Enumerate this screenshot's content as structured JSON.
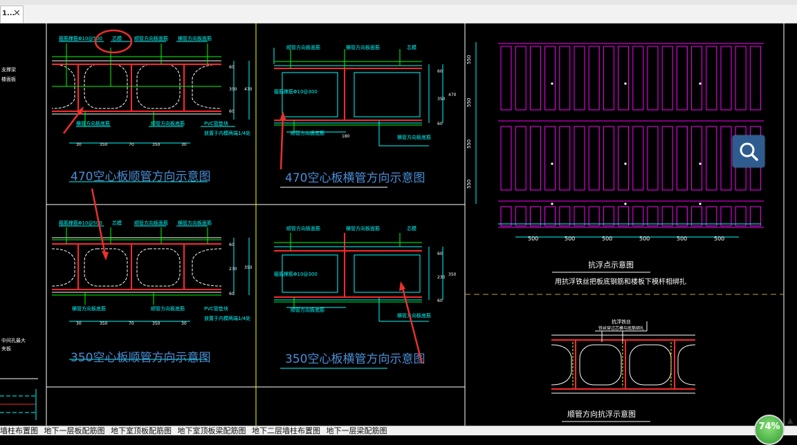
{
  "window": {
    "tab_label": "1...",
    "tab_close_glyph": "✕"
  },
  "drawing": {
    "panel_470_longitudinal": {
      "title": "470空心板顺管方向示意图",
      "labels": [
        "箍筋撑筋Φ10@500",
        "芯模",
        "顺管方向板面筋",
        "横管方向板面筋",
        "横管方向板底筋",
        "顺管方向板底筋",
        "PVC管垫块",
        "放置于内模两端1/4处"
      ],
      "dims": [
        "30",
        "350",
        "70",
        "350",
        "30"
      ],
      "vdims": [
        "60",
        "350",
        "60",
        "470"
      ]
    },
    "panel_470_transverse": {
      "title": "470空心板横管方向示意图",
      "labels": [
        "顺管方向板面筋",
        "横管方向板面筋",
        "芯模",
        "箍筋撑筋Φ10@300",
        "顺管方向板底筋",
        "横管方向板底筋"
      ],
      "dims": [
        "180"
      ],
      "vdims": [
        "60",
        "350",
        "60",
        "470"
      ]
    },
    "panel_350_longitudinal": {
      "title": "350空心板顺管方向示意图",
      "labels": [
        "箍筋撑筋Φ10@500",
        "芯模",
        "顺管方向板面筋",
        "横管方向板面筋",
        "横管方向板底筋",
        "顺管方向板底筋",
        "PVC管垫块",
        "放置于内模两端1/4处"
      ],
      "dims": [
        "30",
        "350",
        "70",
        "350",
        "30"
      ],
      "vdims": [
        "60",
        "230",
        "60",
        "350"
      ]
    },
    "panel_350_transverse": {
      "title": "350空心板横管方向示意图",
      "labels": [
        "顺管方向板面筋",
        "横管方向板面筋",
        "芯模",
        "箍筋撑筋Φ10@300",
        "顺管方向板底筋",
        "横管方向板底筋"
      ],
      "vdims": [
        "60",
        "230",
        "60",
        "350"
      ]
    },
    "anti_float_plan": {
      "title": "抗浮点示意图",
      "subtitle": "用抗浮铁丝把板底钢筋和楼板下模杆相绑扎",
      "vdims": [
        "550",
        "550",
        "550",
        "550"
      ],
      "hdims": [
        "500",
        "500",
        "500",
        "500",
        "500",
        "500"
      ]
    },
    "anti_float_section": {
      "title": "顺管方向抗浮示意图",
      "label": "抗浮铁丝",
      "sublabel": "铁丝穿过芯模与底筋绑扎"
    },
    "left_fragments": [
      "支撑梁",
      "楼面板",
      "中间孔最大",
      "夹板"
    ]
  },
  "sheet_tabs": [
    "墙柱布置图",
    "地下一层板配筋图",
    "地下室顶板配筋图",
    "地下室顶板梁配筋图",
    "地下二层墙柱布置图",
    "地下一层梁配筋图"
  ],
  "search_icon": "search-icon",
  "zoom": {
    "value": "74%"
  },
  "colors": {
    "background": "#000000",
    "cyan": "#00ffff",
    "white": "#ffffff",
    "red": "#ff2a2a",
    "green": "#00ff00",
    "magenta": "#ff00ff",
    "yellow": "#ffff00",
    "title_blue": "#4a8fd8",
    "annotation_red": "#e8312e"
  }
}
